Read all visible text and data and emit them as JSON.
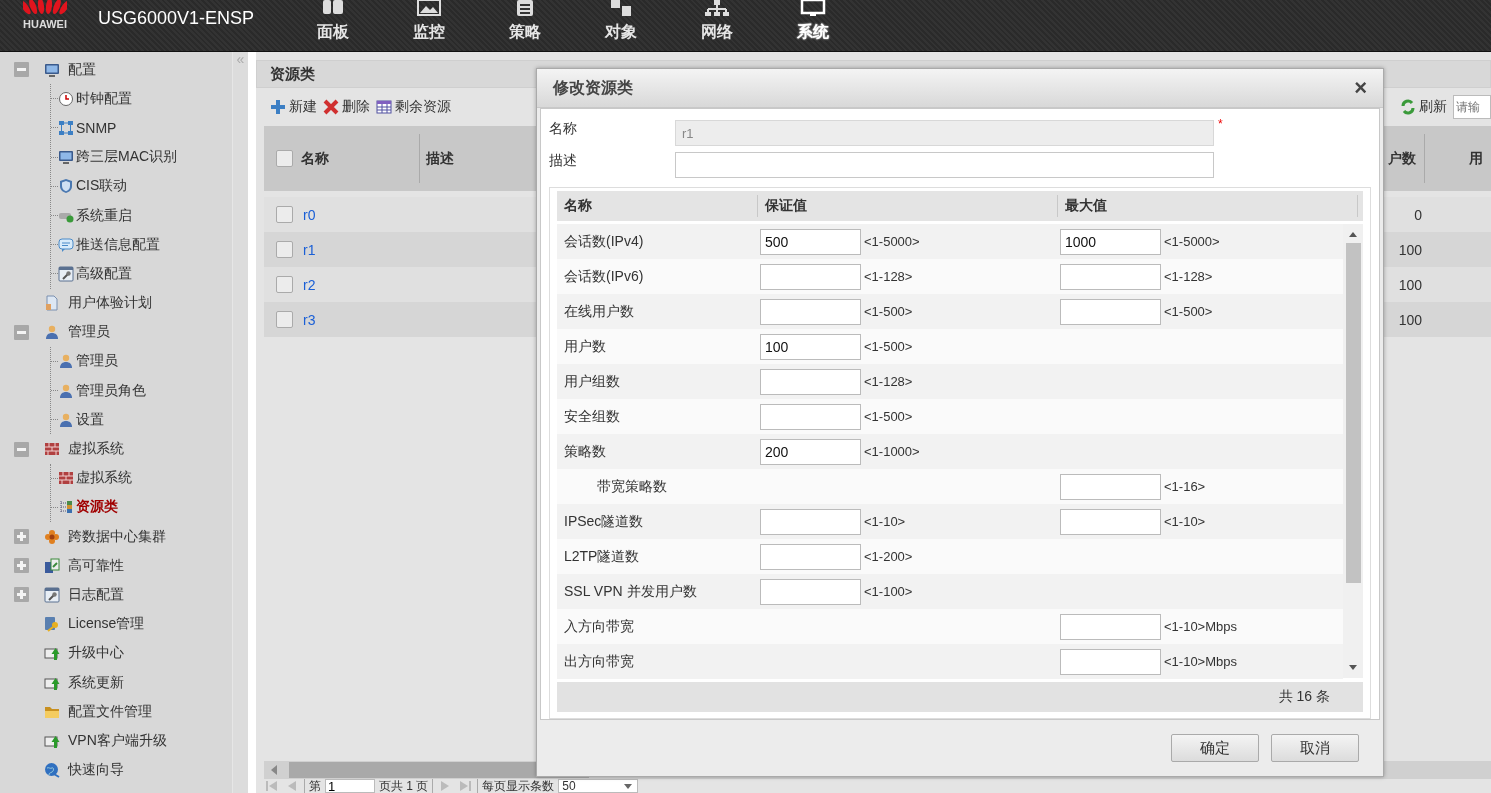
{
  "header": {
    "logo_text": "HUAWEI",
    "device": "USG6000V1-ENSP",
    "nav": [
      {
        "label": "面板",
        "selected": false
      },
      {
        "label": "监控",
        "selected": false
      },
      {
        "label": "策略",
        "selected": false
      },
      {
        "label": "对象",
        "selected": false
      },
      {
        "label": "网络",
        "selected": false
      },
      {
        "label": "系统",
        "selected": true
      }
    ]
  },
  "sidebar": {
    "collapse": "«",
    "items": [
      {
        "label": "配置",
        "expanded": true,
        "selected": false,
        "children": [
          {
            "label": "时钟配置",
            "selected": false
          },
          {
            "label": "SNMP",
            "selected": false
          },
          {
            "label": "跨三层MAC识别",
            "selected": false
          },
          {
            "label": "CIS联动",
            "selected": false
          },
          {
            "label": "系统重启",
            "selected": false
          },
          {
            "label": "推送信息配置",
            "selected": false
          },
          {
            "label": "高级配置",
            "selected": false
          }
        ]
      },
      {
        "label": "用户体验计划",
        "selected": false
      },
      {
        "label": "管理员",
        "expanded": true,
        "selected": false,
        "children": [
          {
            "label": "管理员",
            "selected": false
          },
          {
            "label": "管理员角色",
            "selected": false
          },
          {
            "label": "设置",
            "selected": false
          }
        ]
      },
      {
        "label": "虚拟系统",
        "expanded": true,
        "selected": false,
        "children": [
          {
            "label": "虚拟系统",
            "selected": false
          },
          {
            "label": "资源类",
            "selected": true
          }
        ]
      },
      {
        "label": "跨数据中心集群",
        "expanded": false,
        "selected": false
      },
      {
        "label": "高可靠性",
        "expanded": false,
        "selected": false
      },
      {
        "label": "日志配置",
        "expanded": false,
        "selected": false
      },
      {
        "label": "License管理",
        "selected": false
      },
      {
        "label": "升级中心",
        "selected": false
      },
      {
        "label": "系统更新",
        "selected": false
      },
      {
        "label": "配置文件管理",
        "selected": false
      },
      {
        "label": "VPN客户端升级",
        "selected": false
      },
      {
        "label": "快速向导",
        "selected": false
      }
    ]
  },
  "panel": {
    "title": "资源类",
    "toolbar": [
      {
        "label": "新建"
      },
      {
        "label": "删除"
      },
      {
        "label": "剩余资源"
      }
    ],
    "refresh": "刷新",
    "search": {
      "placeholder": "请输"
    },
    "table": {
      "header_checked": false,
      "columns": [
        "名称",
        "描述",
        "户数",
        "用"
      ],
      "rows": [
        {
          "name": "r0",
          "checked": false,
          "column_3": "0"
        },
        {
          "name": "r1",
          "checked": false,
          "column_3": "100"
        },
        {
          "name": "r2",
          "checked": false,
          "column_3": "100"
        },
        {
          "name": "r3",
          "checked": false,
          "column_3": "100"
        }
      ]
    },
    "pager": {
      "page_label": "第",
      "page": "1",
      "total": "页共 1 页",
      "per_page_label": "每页显示条数",
      "per_page": "50"
    }
  },
  "dialog": {
    "title": "修改资源类",
    "close": "×",
    "fields": [
      {
        "label": "名称",
        "value": "r1",
        "disabled": true,
        "marker": "*"
      },
      {
        "label": "描述",
        "disabled": false
      }
    ],
    "grid": {
      "columns": [
        "名称",
        "保证值",
        "最大值"
      ],
      "rows": [
        {
          "name": "会话数(IPv4)",
          "guaranteed": {
            "value": "500",
            "range": "<1-5000>"
          },
          "maximum": {
            "value": "1000",
            "range": "<1-5000>"
          }
        },
        {
          "name": "会话数(IPv6)",
          "guaranteed": {
            "range": "<1-128>"
          },
          "maximum": {
            "range": "<1-128>"
          }
        },
        {
          "name": "在线用户数",
          "guaranteed": {
            "range": "<1-500>"
          },
          "maximum": {
            "range": "<1-500>"
          }
        },
        {
          "name": "用户数",
          "guaranteed": {
            "value": "100",
            "range": "<1-500>"
          }
        },
        {
          "name": "用户组数",
          "guaranteed": {
            "range": "<1-128>"
          }
        },
        {
          "name": "安全组数",
          "guaranteed": {
            "range": "<1-500>"
          }
        },
        {
          "name": "策略数",
          "guaranteed": {
            "value": "200",
            "range": "<1-1000>"
          },
          "children": [
            {
              "name": "带宽策略数",
              "maximum": {
                "range": "<1-16>"
              }
            }
          ]
        },
        {
          "name": "IPSec隧道数",
          "guaranteed": {
            "range": "<1-10>"
          },
          "maximum": {
            "range": "<1-10>"
          }
        },
        {
          "name": "L2TP隧道数",
          "guaranteed": {
            "range": "<1-200>"
          }
        },
        {
          "name": "SSL VPN 并发用户数",
          "guaranteed": {
            "range": "<1-100>"
          }
        },
        {
          "name": "入方向带宽",
          "maximum": {
            "range": "<1-10>Mbps"
          }
        },
        {
          "name": "出方向带宽",
          "maximum": {
            "range": "<1-10>Mbps"
          }
        }
      ],
      "footer": "共 16 条"
    },
    "buttons": [
      "确定",
      "取消"
    ]
  }
}
